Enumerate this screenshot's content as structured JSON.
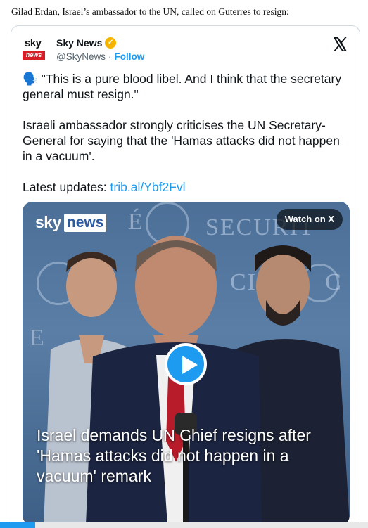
{
  "intro_text": "Gilad Erdan, Israel’s ambassador to the UN, called on Guterres to resign:",
  "tweet": {
    "author_name": "Sky News",
    "author_handle": "@SkyNews",
    "separator": "·",
    "follow_label": "Follow",
    "avatar": {
      "sky": "sky",
      "news": "news"
    },
    "quote_line": "🗣️ \"This is a pure blood libel. And I think that the secretary general must resign.\"",
    "description": "Israeli ambassador strongly criticises the UN Secretary-General for saying that the 'Hamas attacks did not happen in a vacuum'.",
    "updates_label": "Latest updates:",
    "updates_link": "trib.al/Ybf2Fvl",
    "close_icon": "x-logo-icon",
    "verified_icon": "verified-badge-icon",
    "verified_color": "#f4b400"
  },
  "media": {
    "logo_sky": "sky",
    "logo_news": "news",
    "watch_label": "Watch on X",
    "caption": "Israel demands UN Chief resigns after 'Hamas attacks did not happen in a vacuum' remark",
    "play_icon": "play-icon",
    "accent_color": "#1d9bf0"
  }
}
